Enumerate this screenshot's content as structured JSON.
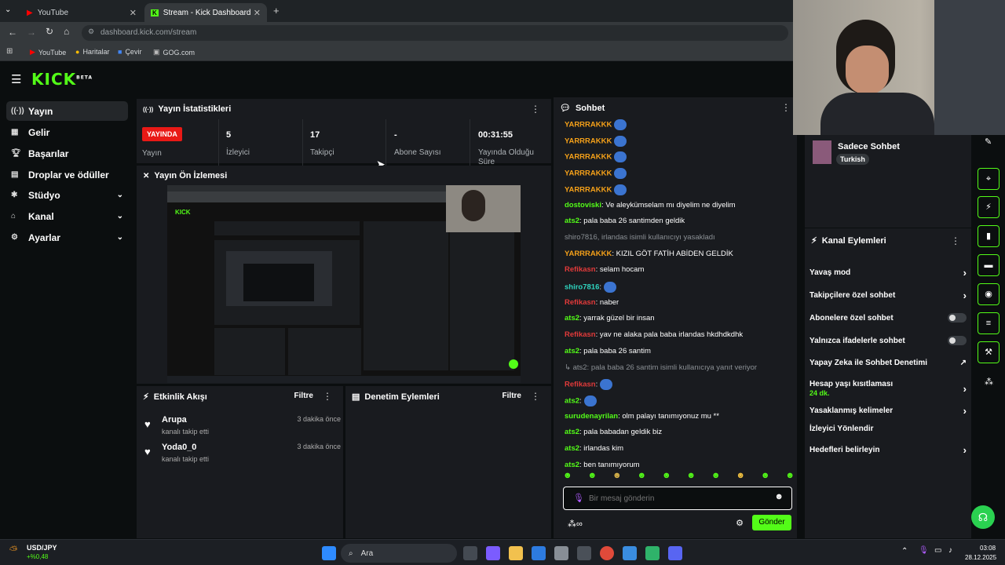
{
  "browser": {
    "tabs": [
      {
        "title": "YouTube"
      },
      {
        "title": "Stream - Kick Dashboard"
      }
    ],
    "url": "dashboard.kick.com/stream",
    "bookmarks": [
      "YouTube",
      "Haritalar",
      "Çevir",
      "GOG.com"
    ]
  },
  "brand": {
    "logo": "KICK",
    "badge": "BETA"
  },
  "sidebar": {
    "items": [
      {
        "label": "Yayın",
        "icon": "broadcast-icon",
        "active": true
      },
      {
        "label": "Gelir",
        "icon": "revenue-icon"
      },
      {
        "label": "Başarılar",
        "icon": "trophy-icon"
      },
      {
        "label": "Droplar ve ödüller",
        "icon": "gift-icon"
      },
      {
        "label": "Stüdyo",
        "icon": "studio-icon",
        "expandable": true
      },
      {
        "label": "Kanal",
        "icon": "channel-icon",
        "expandable": true
      },
      {
        "label": "Ayarlar",
        "icon": "gear-icon",
        "expandable": true
      }
    ]
  },
  "stats": {
    "title": "Yayın İstatistikleri",
    "live_badge": "YAYINDA",
    "live_label": "Yayın",
    "viewers_value": "5",
    "viewers_label": "İzleyici",
    "followers_value": "17",
    "followers_label": "Takipçi",
    "subs_value": "-",
    "subs_label": "Abone Sayısı",
    "uptime_value": "00:31:55",
    "uptime_label": "Yayında Olduğu Süre"
  },
  "preview": {
    "title": "Yayın Ön İzlemesi"
  },
  "activity": {
    "title": "Etkinlik Akışı",
    "filter": "Filtre",
    "items": [
      {
        "name": "Arupa",
        "sub": "kanalı takip etti",
        "time": "3 dakika önce"
      },
      {
        "name": "Yoda0_0",
        "sub": "kanalı takip etti",
        "time": "3 dakika önce"
      }
    ]
  },
  "moderation": {
    "title": "Denetim Eylemleri",
    "filter": "Filtre"
  },
  "chat": {
    "title": "Sohbet",
    "messages": [
      {
        "user": "YARRRAKKK",
        "text": "",
        "color": "y",
        "emote": true
      },
      {
        "user": "YARRRAKKK",
        "text": "",
        "color": "y",
        "emote": true
      },
      {
        "user": "YARRRAKKK",
        "text": "",
        "color": "y",
        "emote": true
      },
      {
        "user": "YARRRAKKK",
        "text": "",
        "color": "y",
        "emote": true
      },
      {
        "user": "YARRRAKKK",
        "text": "",
        "color": "y",
        "emote": true
      },
      {
        "user": "dostoviski",
        "text": ": Ve aleykümselam mı diyelim ne diyelim",
        "color": "g"
      },
      {
        "user": "ats2",
        "text": ": pala baba 26 santimden geldik",
        "color": "g"
      },
      {
        "user": "",
        "text": "shiro7816, irlandas isimli kullanıcıyı yasakladı",
        "color": "sys"
      },
      {
        "user": "YARRRAKKK",
        "text": ": KIZIL GÖT FATİH ABİDEN GELDİK",
        "color": "y"
      },
      {
        "user": "Refikasn",
        "text": ": selam hocam",
        "color": "r"
      },
      {
        "user": "shiro7816",
        "text": ":",
        "color": "tq",
        "emote": true
      },
      {
        "user": "Refikasn",
        "text": ": naber",
        "color": "r"
      },
      {
        "user": "ats2",
        "text": ": yarrak güzel bir insan",
        "color": "g"
      },
      {
        "user": "Refikasn",
        "text": ": yav ne alaka pala baba irlandas hkdhdkdhk",
        "color": "r"
      },
      {
        "user": "ats2",
        "text": ": pala baba 26 santim",
        "color": "g"
      },
      {
        "user": "",
        "text": "↳ ats2: pala baba 26 santim isimli kullanıcıya yanıt veriyor",
        "color": "sys"
      },
      {
        "user": "Refikasn",
        "text": ":",
        "color": "r",
        "emote": true
      },
      {
        "user": "ats2",
        "text": ":",
        "color": "g",
        "emote": true
      },
      {
        "user": "surudenayrilan",
        "text": ": olm palayı tanımıyonuz mu **",
        "color": "g"
      },
      {
        "user": "ats2",
        "text": ": pala babadan geldik biz",
        "color": "g"
      },
      {
        "user": "ats2",
        "text": ": irlandas kim",
        "color": "g"
      },
      {
        "user": "ats2",
        "text": ": ben tanımıyorum",
        "color": "g"
      }
    ],
    "placeholder": "Bir mesaj gönderin",
    "send": "Gönder"
  },
  "right": {
    "channel_name": "Sadece Sohbet",
    "channel_tag": "Turkish",
    "actions_title": "Kanal Eylemleri",
    "actions": [
      {
        "label": "Yavaş mod",
        "kind": "chevron"
      },
      {
        "label": "Takipçilere özel sohbet",
        "kind": "chevron"
      },
      {
        "label": "Abonelere özel sohbet",
        "kind": "toggle"
      },
      {
        "label": "Yalnızca ifadelerle sohbet",
        "kind": "toggle"
      },
      {
        "label": "Yapay Zeka ile Sohbet Denetimi",
        "kind": "chart"
      },
      {
        "label": "Hesap yaşı kısıtlaması",
        "kind": "chevron",
        "sub": "24 dk."
      },
      {
        "label": "Yasaklanmış kelimeler",
        "kind": "chevron"
      },
      {
        "label": "İzleyici Yönlendir",
        "kind": "none"
      },
      {
        "label": "Hedefleri belirleyin",
        "kind": "chevron"
      }
    ]
  },
  "taskbar": {
    "ticker": "USD/JPY",
    "ticker_change": "+%0,48",
    "search": "Ara",
    "time": "03:08",
    "date": "28.12.2025"
  }
}
